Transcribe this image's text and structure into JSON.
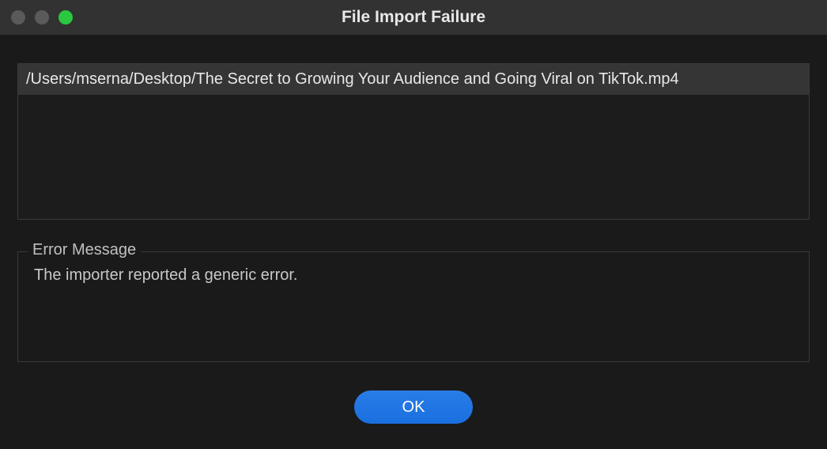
{
  "window": {
    "title": "File Import Failure"
  },
  "filelist": {
    "items": [
      "/Users/mserna/Desktop/The Secret to Growing Your Audience and Going Viral on TikTok.mp4"
    ]
  },
  "error_section": {
    "legend": "Error Message",
    "message": "The importer reported a generic error."
  },
  "buttons": {
    "ok_label": "OK"
  },
  "colors": {
    "accent": "#1d74e5",
    "background": "#1a1a1a",
    "titlebar": "#323232"
  }
}
